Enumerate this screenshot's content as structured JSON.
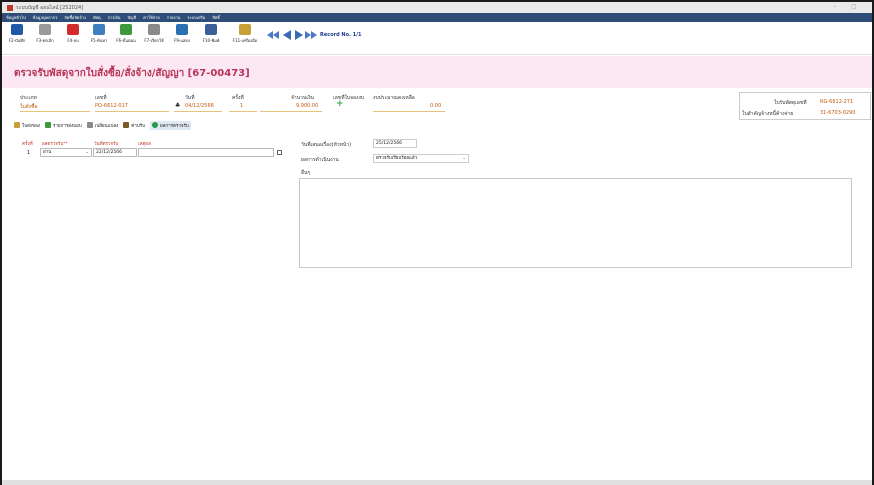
{
  "window": {
    "title": "ระบบบัญชี ออนไลน์ [252024]"
  },
  "menu": [
    "ข้อมูลทั่วไป",
    "ข้อมูลบุคลากร",
    "จัดซื้อจัดจ้าง",
    "พัสดุ",
    "การเงิน",
    "บัญชี",
    "ค่าใช้จ่าย",
    "รายงาน",
    "ระบบเสริม",
    "สิทธิ์"
  ],
  "toolbar": {
    "buttons": [
      {
        "label": "F2-บันทึก",
        "icon": "save-icon",
        "color": "#1f5aa8"
      },
      {
        "label": "F3-ยกเลิก",
        "icon": "cancel-icon",
        "color": "#9a9a9a"
      },
      {
        "label": "F4-ลบ",
        "icon": "delete-icon",
        "color": "#d12a2a"
      },
      {
        "label": "F5-ค้นหา",
        "icon": "search-icon",
        "color": "#3f7fbf"
      },
      {
        "label": "F6-ขั้นตอน",
        "icon": "workflow-icon",
        "color": "#3c9a3c"
      },
      {
        "label": "F7-เรียกใช้",
        "icon": "recall-icon",
        "color": "#8a8a8a"
      },
      {
        "label": "F9-แสดง",
        "icon": "display-icon",
        "color": "#2a6fb2"
      },
      {
        "label": "F10-พิมพ์",
        "icon": "print-icon",
        "color": "#3a5f9a"
      },
      {
        "label": "F11-เครื่องมือ",
        "icon": "tools-icon",
        "color": "#c7a03a"
      }
    ],
    "record": "Record No. 1/1"
  },
  "breadcrumb": "ตรวจรับพัสดุจากใบสั่งซื้อ/สั่งจ้าง/สัญญา",
  "page_title": "ตรวจรับพัสดุจากใบสั่งซื้อ/สั่งจ้าง/สัญญา [67-00473]",
  "fields": {
    "type_label": "ประเภท",
    "type_value": "ใบสั่งซื้อ",
    "doc_label": "เลขที่",
    "doc_value": "PO-6612-017",
    "date_label": "วันที่",
    "date_value": "04/12/2566",
    "round_label": "ครั้งที่",
    "round_value": "1",
    "amount_label": "จำนวนเงิน",
    "amount_value": "9,900.00",
    "reserve_label": "เลขที่ใบจองงบ",
    "remain_label": "งบประมาณคงเหลือ",
    "remain_value": "0.00",
    "receipt_label": "ใบรับพัสดุเลขที่",
    "receipt_value": "RG-6612-271",
    "debt_label": "ใบสำคัญจ้างหนี้ค้างจ่าย",
    "debt_value": "31-6703-0290"
  },
  "tabs": [
    {
      "label": "ใบส่งของ",
      "color": "#c8a03a"
    },
    {
      "label": "รายการส่งมอบ",
      "color": "#3c9a3c"
    },
    {
      "label": "เปลี่ยนแปลง",
      "color": "#8a8a8a"
    },
    {
      "label": "ค่าปรับ",
      "color": "#7a5a2a"
    },
    {
      "label": "ผลการตรวจรับ",
      "color": "#2a9a4a"
    }
  ],
  "inspection": {
    "headers": [
      "ครั้งที่",
      "ผลตรวจรับ**",
      "วันที่ตรวจรับ",
      "เหตุผล"
    ],
    "row": {
      "no": "1",
      "result": "ผ่าน",
      "date": "22/12/2566",
      "reason": ""
    }
  },
  "right": {
    "submit_label": "วันที่เสนอเรื่อง(หัวหน้า)",
    "submit_value": "25/12/2566",
    "status_label": "ผลการดำเนินงาน",
    "status_value": "ตรวจรับเรียบร้อยแล้ว",
    "other_label": "อื่นๆ"
  }
}
